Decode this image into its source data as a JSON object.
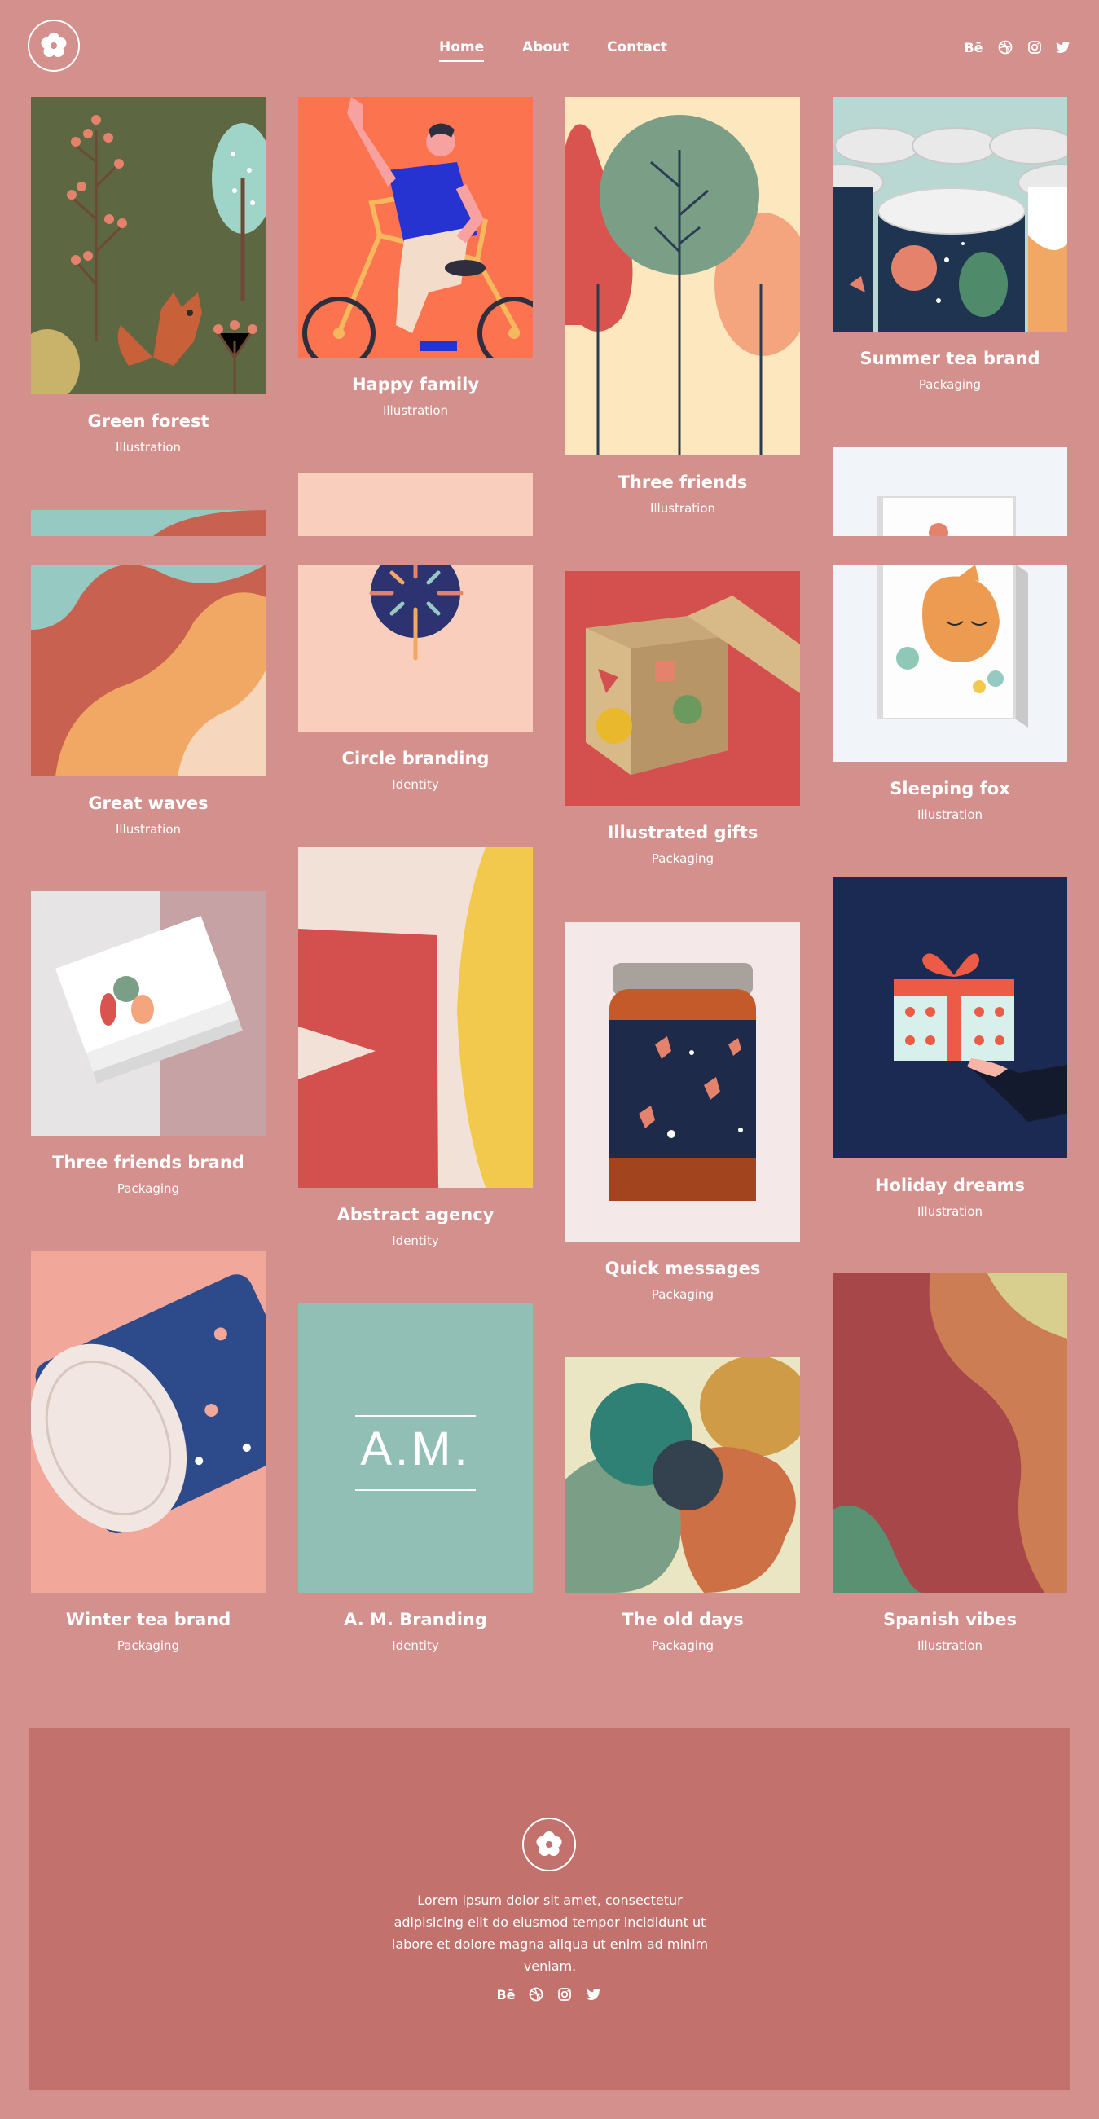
{
  "nav": {
    "items": [
      "Home",
      "About",
      "Contact"
    ],
    "active": "Home"
  },
  "social": [
    "Bē",
    "dribbble-icon",
    "instagram-icon",
    "twitter-icon"
  ],
  "behance_label": "Bē",
  "colors": {
    "background": "#d3908c",
    "footer": "#c2716c"
  },
  "portfolio": [
    {
      "title": "Green forest",
      "category": "Illustration"
    },
    {
      "title": "Happy family",
      "category": "Illustration"
    },
    {
      "title": "Three friends",
      "category": "Illustration"
    },
    {
      "title": "Summer tea brand",
      "category": "Packaging"
    },
    {
      "title": "Great waves",
      "category": "Illustration"
    },
    {
      "title": "Circle branding",
      "category": "Identity"
    },
    {
      "title": "Illustrated gifts",
      "category": "Packaging"
    },
    {
      "title": "Sleeping fox",
      "category": "Illustration"
    },
    {
      "title": "Three friends brand",
      "category": "Packaging"
    },
    {
      "title": "Abstract agency",
      "category": "Identity"
    },
    {
      "title": "Quick messages",
      "category": "Packaging"
    },
    {
      "title": "Holiday dreams",
      "category": "Illustration"
    },
    {
      "title": "Winter tea brand",
      "category": "Packaging"
    },
    {
      "title": "A. M. Branding",
      "category": "Identity"
    },
    {
      "title": "The old days",
      "category": "Packaging"
    },
    {
      "title": "Spanish vibes",
      "category": "Illustration"
    }
  ],
  "am_logo_text": "A.M.",
  "footer": {
    "text": "Lorem ipsum dolor sit amet, consectetur adipisicing elit do eiusmod tempor incididunt ut labore et dolore magna aliqua ut enim ad minim veniam."
  }
}
